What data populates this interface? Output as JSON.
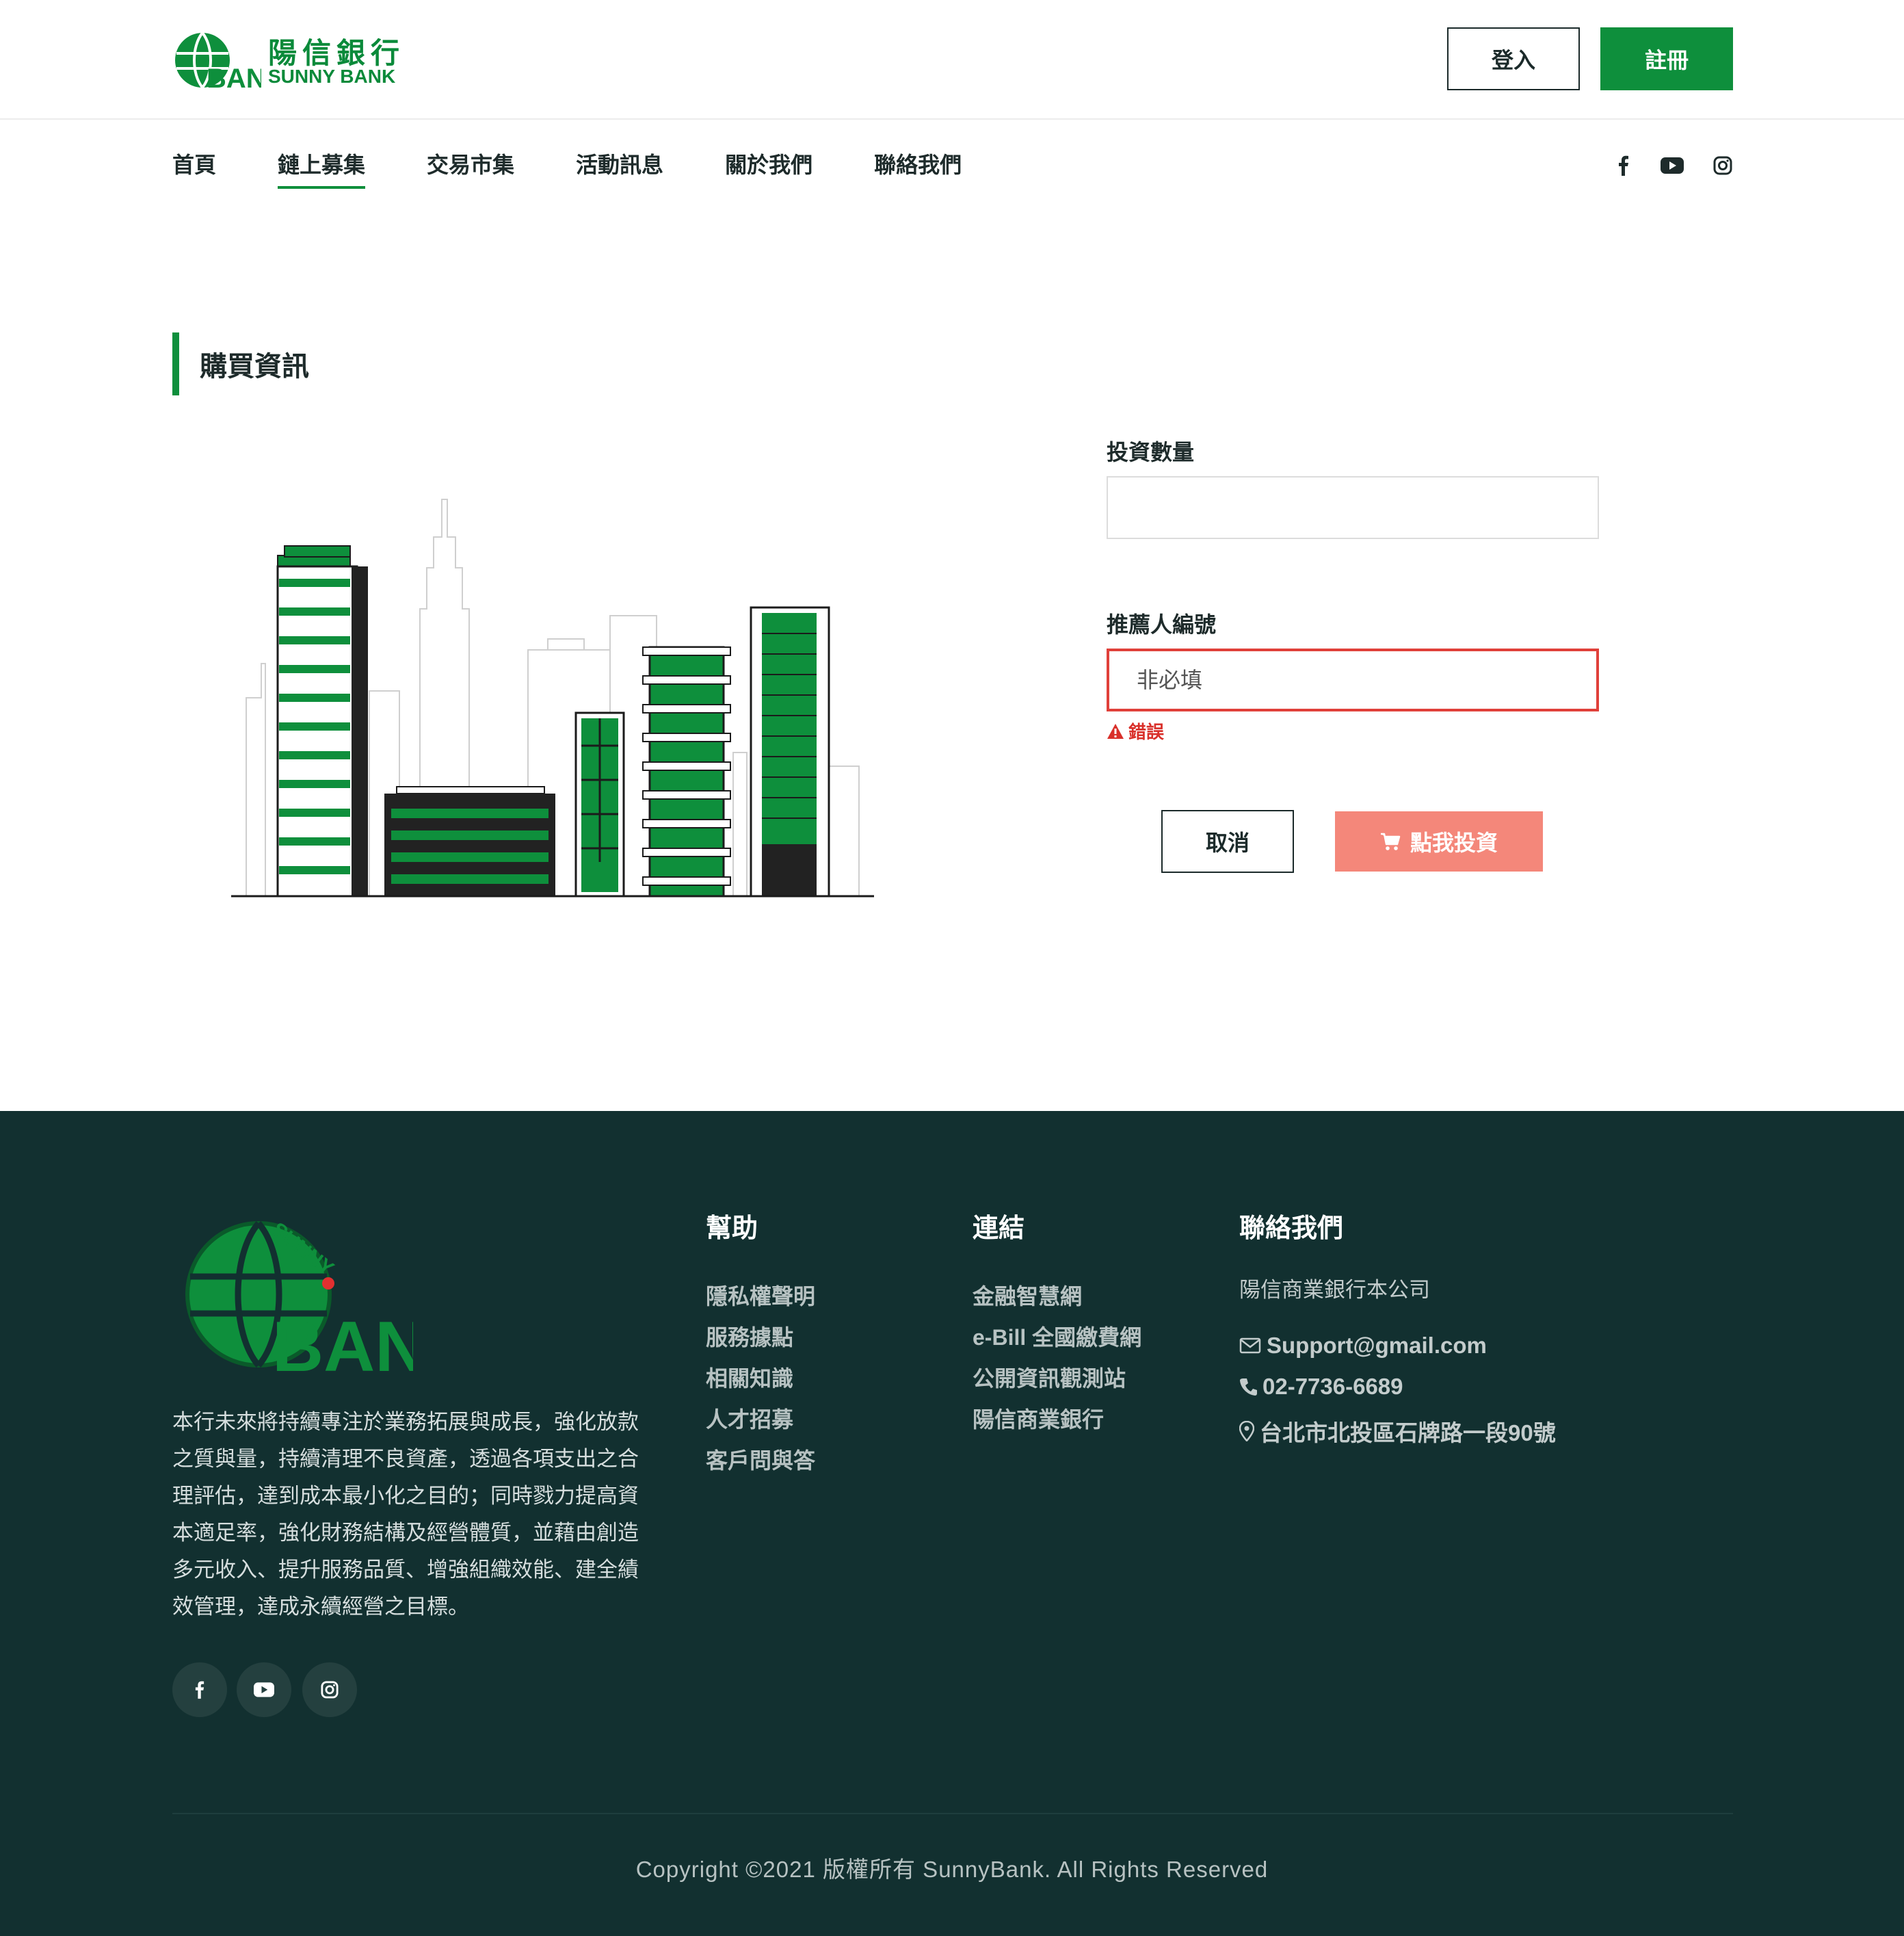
{
  "brand": {
    "name_zh": "陽信銀行",
    "name_en": "SUNNY BANK",
    "logo_text": "BANK",
    "logo_ring_text": "SUNNY"
  },
  "header": {
    "login_label": "登入",
    "register_label": "註冊"
  },
  "nav": {
    "items": [
      {
        "label": "首頁",
        "active": false
      },
      {
        "label": "鏈上募集",
        "active": true
      },
      {
        "label": "交易市集",
        "active": false
      },
      {
        "label": "活動訊息",
        "active": false
      },
      {
        "label": "關於我們",
        "active": false
      },
      {
        "label": "聯絡我們",
        "active": false
      }
    ],
    "social_icons": [
      "facebook-icon",
      "youtube-icon",
      "instagram-icon"
    ]
  },
  "section": {
    "title": "購買資訊"
  },
  "form": {
    "quantity_label": "投資數量",
    "quantity_value": "",
    "referrer_label": "推薦人編號",
    "referrer_placeholder": "非必填",
    "referrer_error": "錯誤",
    "cancel_label": "取消",
    "invest_label": "點我投資"
  },
  "footer": {
    "about": "本行未來將持續專注於業務拓展與成長，強化放款之質與量，持續清理不良資產，透過各項支出之合理評估，達到成本最小化之目的；同時戮力提高資本適足率，強化財務結構及經營體質，並藉由創造多元收入、提升服務品質、增強組織效能、建全績效管理，達成永續經營之目標。",
    "help": {
      "title": "幫助",
      "links": [
        "隱私權聲明",
        "服務據點",
        "相關知識",
        "人才招募",
        "客戶問與答"
      ]
    },
    "links": {
      "title": "連結",
      "links": [
        "金融智慧網",
        "e-Bill 全國繳費網",
        "公開資訊觀測站",
        "陽信商業銀行"
      ]
    },
    "contact": {
      "title": "聯絡我們",
      "company": "陽信商業銀行本公司",
      "email": "Support@gmail.com",
      "phone": "02-7736-6689",
      "address": "台北市北投區石牌路一段90號"
    },
    "copyright": "Copyright ©2021 版權所有 SunnyBank. All Rights Reserved"
  },
  "colors": {
    "brand_green": "#0e8f3c",
    "footer_bg": "#123030",
    "error_red": "#e0403a",
    "invest_button": "#f4877a"
  }
}
